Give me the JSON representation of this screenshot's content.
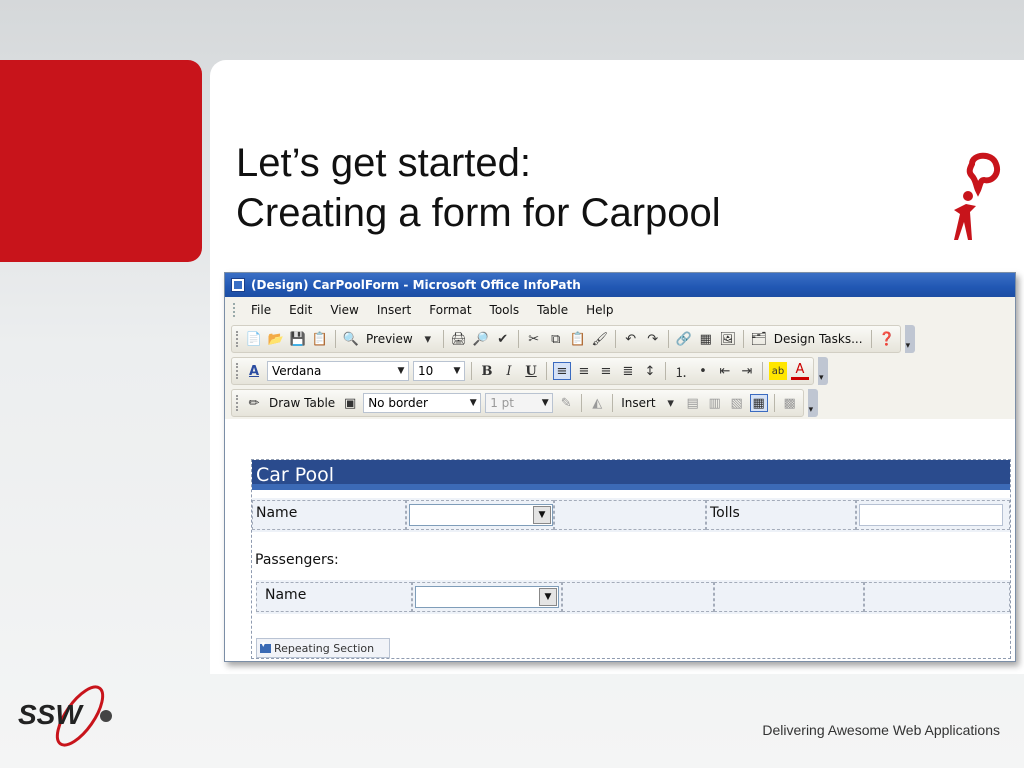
{
  "slide": {
    "title_line1": "Let’s get started:",
    "title_line2": "Creating a form for Carpool",
    "footer": "Delivering Awesome Web Applications",
    "accent_color": "#c8141b",
    "logo_text": "SSW"
  },
  "window": {
    "title": "(Design) CarPoolForm - Microsoft Office InfoPath",
    "menu": [
      "File",
      "Edit",
      "View",
      "Insert",
      "Format",
      "Tools",
      "Table",
      "Help"
    ],
    "toolbar_standard": {
      "preview_label": "Preview",
      "design_tasks_label": "Design Tasks..."
    },
    "toolbar_format": {
      "font_name": "Verdana",
      "font_size": "10",
      "bold": "B",
      "italic": "I",
      "underline": "U"
    },
    "toolbar_table": {
      "draw_table_label": "Draw Table",
      "border_style": "No border",
      "border_width": "1 pt",
      "insert_label": "Insert"
    }
  },
  "form": {
    "header": "Car Pool",
    "name_label": "Name",
    "tolls_label": "Tolls",
    "passengers_label": "Passengers:",
    "passenger_name_label": "Name",
    "repeating_section_label": "Repeating Section"
  }
}
